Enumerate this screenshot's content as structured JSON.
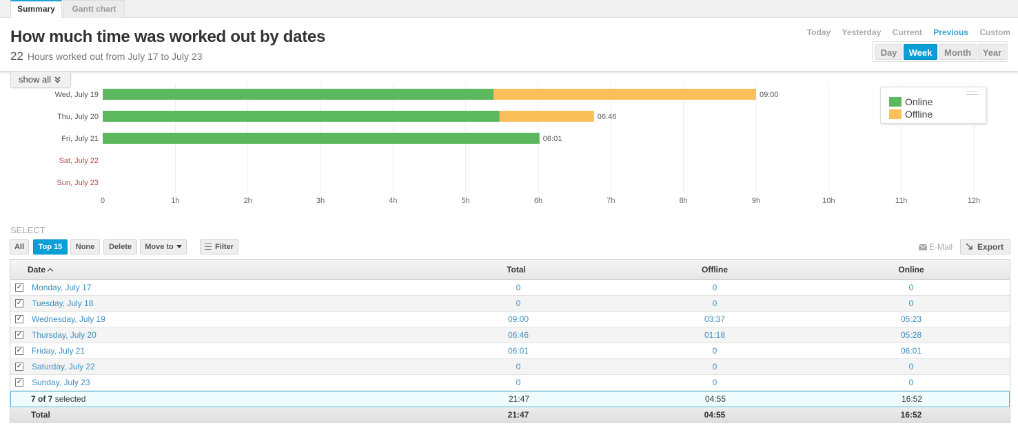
{
  "tabs": [
    {
      "label": "Summary",
      "active": true
    },
    {
      "label": "Gantt chart",
      "active": false
    }
  ],
  "header": {
    "title": "How much time was worked out by dates",
    "subtitle_num": "22",
    "subtitle_text": "Hours worked out from July 17 to July 23"
  },
  "period_links": [
    {
      "label": "Today",
      "active": false
    },
    {
      "label": "Yesterday",
      "active": false
    },
    {
      "label": "Current",
      "active": false
    },
    {
      "label": "Previous",
      "active": true
    },
    {
      "label": "Custom",
      "active": false
    }
  ],
  "scale_buttons": [
    {
      "label": "Day",
      "active": false
    },
    {
      "label": "Week",
      "active": true
    },
    {
      "label": "Month",
      "active": false
    },
    {
      "label": "Year",
      "active": false
    }
  ],
  "show_all_label": "show  all",
  "colors": {
    "online": "#5cb85c",
    "offline": "#fcc05a",
    "weekend_label": "#b94a48",
    "accent": "#0a9fd6"
  },
  "chart_data": {
    "type": "bar",
    "orientation": "horizontal",
    "stacked": true,
    "categories": [
      "Wed, July 19",
      "Thu, July 20",
      "Fri, July 21",
      "Sat, July 22",
      "Sun, July 23"
    ],
    "weekend_categories": [
      "Sat, July 22",
      "Sun, July 23"
    ],
    "series": [
      {
        "name": "Online",
        "values": [
          5.383,
          5.467,
          6.017,
          0,
          0
        ]
      },
      {
        "name": "Offline",
        "values": [
          3.617,
          1.3,
          0,
          0,
          0
        ]
      }
    ],
    "data_labels": [
      "09:00",
      "06:46",
      "06:01",
      "",
      ""
    ],
    "x_ticks": [
      "0",
      "1h",
      "2h",
      "3h",
      "4h",
      "5h",
      "6h",
      "7h",
      "8h",
      "9h",
      "10h",
      "11h",
      "12h"
    ],
    "xlim": [
      0,
      12
    ],
    "grid": true,
    "legend": "top-right"
  },
  "select": {
    "label": "SELECT",
    "buttons": [
      "All",
      "Top 15",
      "None",
      "Delete",
      "Move to"
    ],
    "active": "Top 15",
    "filter": "Filter",
    "email": "E-Mail",
    "export": "Export"
  },
  "table": {
    "columns": [
      "Date",
      "Total",
      "Offline",
      "Online"
    ],
    "rows": [
      {
        "date": "Monday, July 17",
        "total": "0",
        "offline": "0",
        "online": "0",
        "checked": true
      },
      {
        "date": "Tuesday, July 18",
        "total": "0",
        "offline": "0",
        "online": "0",
        "checked": true
      },
      {
        "date": "Wednesday, July 19",
        "total": "09:00",
        "offline": "03:37",
        "online": "05:23",
        "checked": true
      },
      {
        "date": "Thursday, July 20",
        "total": "06:46",
        "offline": "01:18",
        "online": "05:28",
        "checked": true
      },
      {
        "date": "Friday, July 21",
        "total": "06:01",
        "offline": "0",
        "online": "06:01",
        "checked": true
      },
      {
        "date": "Saturday, July 22",
        "total": "0",
        "offline": "0",
        "online": "0",
        "checked": true
      },
      {
        "date": "Sunday, July 23",
        "total": "0",
        "offline": "0",
        "online": "0",
        "checked": true
      }
    ],
    "selected": {
      "count": "7 of 7",
      "suffix": "selected",
      "total": "21:47",
      "offline": "04:55",
      "online": "16:52"
    },
    "total": {
      "label": "Total",
      "total": "21:47",
      "offline": "04:55",
      "online": "16:52"
    }
  }
}
